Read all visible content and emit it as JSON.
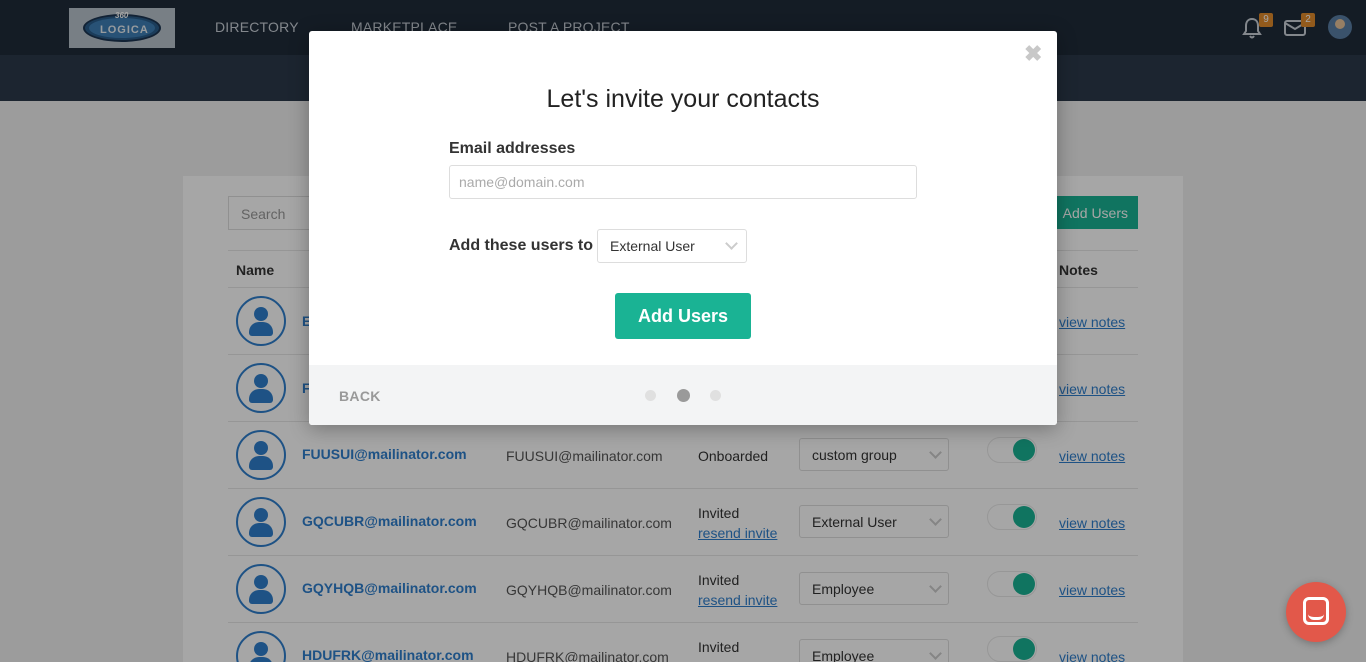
{
  "nav": {
    "logo_text_top": "360",
    "logo_text": "LOGICA",
    "links": [
      "DIRECTORY",
      "MARKETPLACE",
      "POST A PROJECT"
    ],
    "notifications_count": "9",
    "messages_count": "2"
  },
  "table": {
    "search_placeholder": "Search",
    "add_users_label": "Add Users",
    "headers": {
      "name": "Name",
      "notes": "Notes"
    },
    "rows": [
      {
        "name": "E",
        "email": "",
        "status": "",
        "resend": "",
        "group": "",
        "notes": "view notes"
      },
      {
        "name": "F",
        "email": "",
        "status": "",
        "resend": "",
        "group": "",
        "notes": "view notes"
      },
      {
        "name": "FUUSUI@mailinator.com",
        "email": "FUUSUI@mailinator.com",
        "status": "Onboarded",
        "resend": "",
        "group": "custom group",
        "notes": "view notes"
      },
      {
        "name": "GQCUBR@mailinator.com",
        "email": "GQCUBR@mailinator.com",
        "status": "Invited",
        "resend": "resend invite",
        "group": "External User",
        "notes": "view notes"
      },
      {
        "name": "GQYHQB@mailinator.com",
        "email": "GQYHQB@mailinator.com",
        "status": "Invited",
        "resend": "resend invite",
        "group": "Employee",
        "notes": "view notes"
      },
      {
        "name": "HDUFRK@mailinator.com",
        "email": "HDUFRK@mailinator.com",
        "status": "Invited",
        "resend": "",
        "group": "Employee",
        "notes": "view notes"
      }
    ]
  },
  "modal": {
    "close_glyph": "✖",
    "title": "Let's invite your contacts",
    "email_label": "Email addresses",
    "email_placeholder": "name@domain.com",
    "email_value": "",
    "add_to_label": "Add these users to",
    "add_to_value": "External User",
    "add_button": "Add Users",
    "back_label": "BACK",
    "step": {
      "current": 2,
      "total": 3
    }
  },
  "colors": {
    "accent": "#1ab394",
    "link": "#2f7fcc",
    "nav_bg": "#1f2b3a",
    "chat": "#e2584a"
  }
}
